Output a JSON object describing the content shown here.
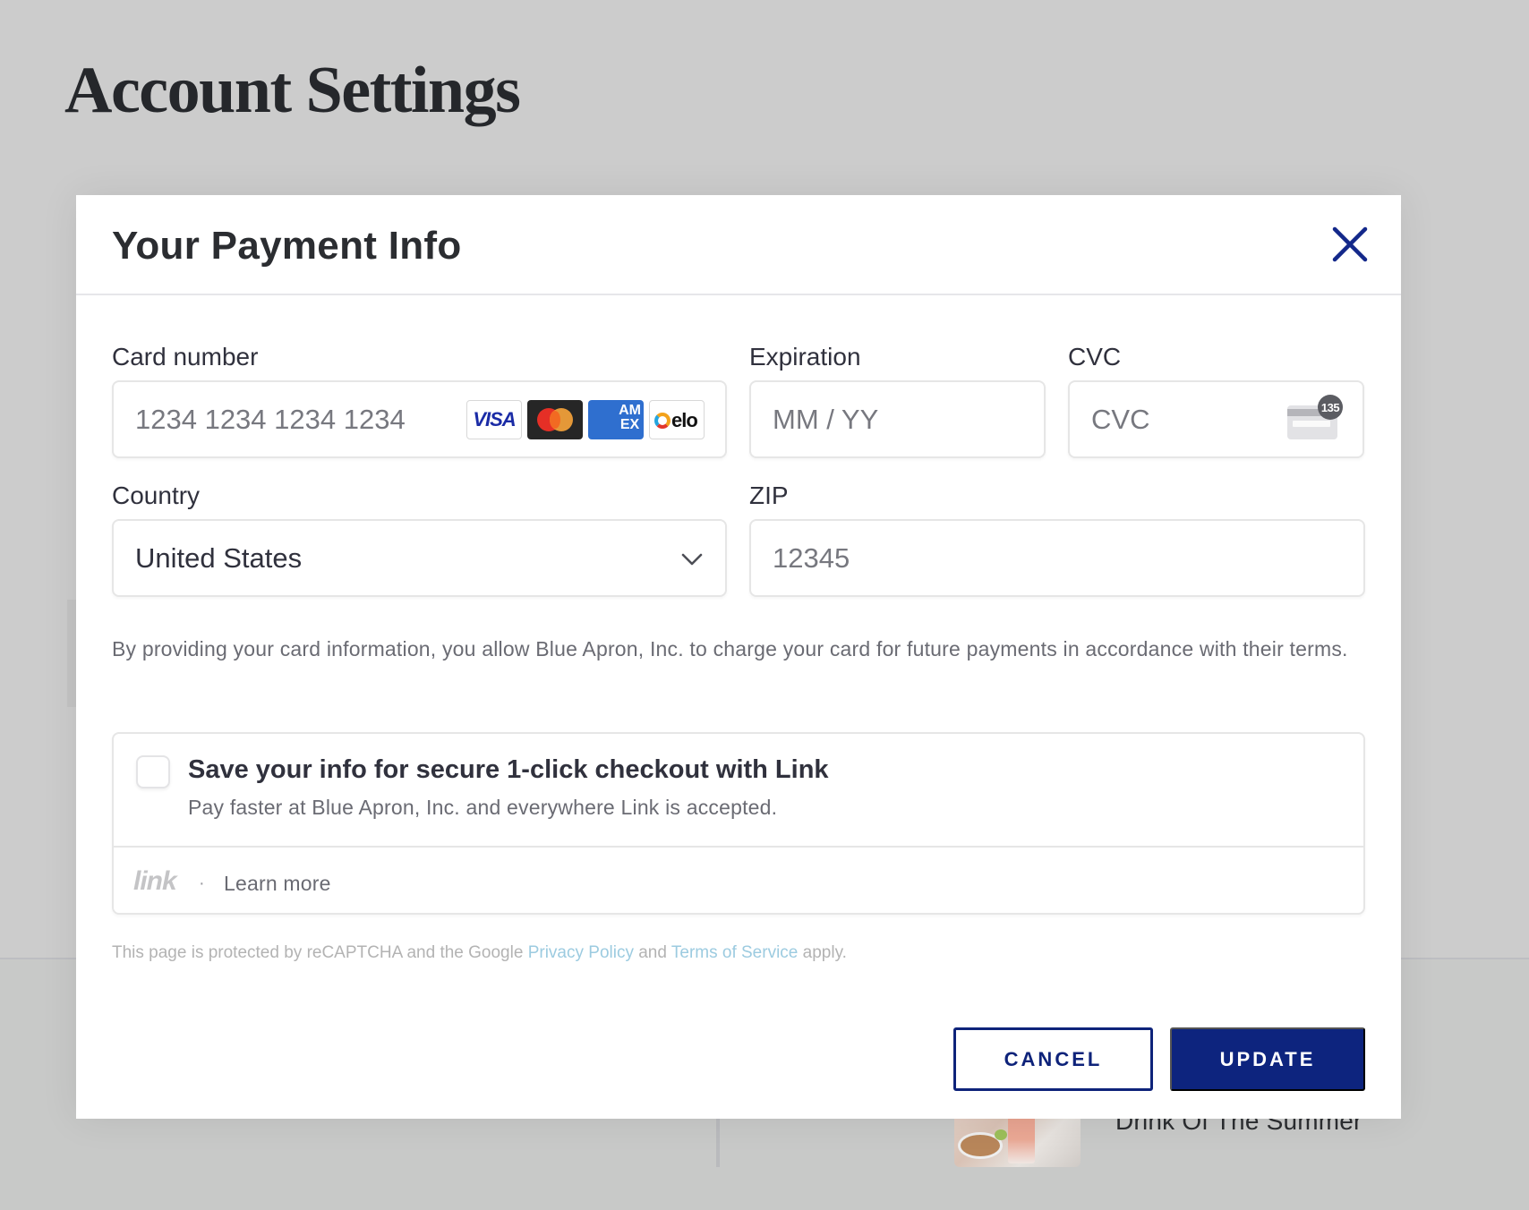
{
  "page": {
    "title": "Account Settings",
    "article_title": "Drink Of The Summer"
  },
  "modal": {
    "title": "Your Payment Info",
    "close_icon": "close-icon",
    "accent_color": "#0d247e",
    "card_number": {
      "label": "Card number",
      "placeholder": "1234 1234 1234 1234",
      "brands": [
        "VISA",
        "Mastercard",
        "AMEX",
        "elo"
      ]
    },
    "expiration": {
      "label": "Expiration",
      "placeholder": "MM / YY"
    },
    "cvc": {
      "label": "CVC",
      "placeholder": "CVC",
      "icon_badge": "135"
    },
    "country": {
      "label": "Country",
      "value": "United States"
    },
    "zip": {
      "label": "ZIP",
      "placeholder": "12345"
    },
    "disclaimer": "By providing your card information, you allow Blue Apron, Inc. to charge your card for future payments in accordance with their terms.",
    "link": {
      "checkbox_checked": false,
      "title": "Save your info for secure 1-click checkout with Link",
      "subtitle": "Pay faster at Blue Apron, Inc. and everywhere Link is accepted.",
      "logo_text": "link",
      "separator": "·",
      "learn_more": "Learn more"
    },
    "recaptcha": {
      "prefix": "This page is protected by reCAPTCHA and the Google",
      "privacy_policy": "Privacy Policy",
      "and": "and",
      "terms": "Terms of Service",
      "suffix": "apply."
    },
    "buttons": {
      "cancel": "CANCEL",
      "update": "UPDATE"
    }
  }
}
